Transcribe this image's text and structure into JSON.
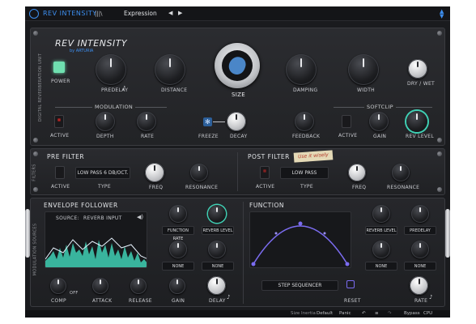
{
  "topbar": {
    "brand": "REV INTENSITY",
    "preset_name": "Expression"
  },
  "main": {
    "title": "REV INTENSITY",
    "subtitle": "by ARTURIA",
    "side_label": "DIGITAL REVERBERATION UNIT",
    "power_label": "POWER",
    "predelay_label": "PREDELAY",
    "distance_label": "DISTANCE",
    "size_label": "SIZE",
    "damping_label": "DAMPING",
    "width_label": "WIDTH",
    "drywet_label": "DRY / WET",
    "modulation_title": "MODULATION",
    "mod_active_label": "ACTIVE",
    "depth_label": "DEPTH",
    "rate_label": "RATE",
    "freeze_label": "FREEZE",
    "decay_label": "DECAY",
    "softclip_title": "SOFTCLIP",
    "feedback_label": "FEEDBACK",
    "sc_active_label": "ACTIVE",
    "gain_label": "GAIN",
    "revlevel_label": "REV LEVEL"
  },
  "filters": {
    "side_label": "FILTERS",
    "pre": {
      "title": "PRE FILTER",
      "active_label": "ACTIVE",
      "type_value": "LOW PASS 6 DB/OCT.",
      "type_label": "TYPE",
      "freq_label": "FREQ",
      "resonance_label": "RESONANCE"
    },
    "post": {
      "title": "POST FILTER",
      "active_label": "ACTIVE",
      "type_value": "LOW PASS",
      "type_label": "TYPE",
      "freq_label": "FREQ",
      "resonance_label": "RESONANCE",
      "sticky_note": "Use it wisely"
    }
  },
  "modulation": {
    "side_label": "MODULATION SOURCES",
    "envelope": {
      "title": "ENVELOPE FOLLOWER",
      "source_label": "SOURCE:",
      "source_value": "REVERB INPUT",
      "comp_label": "COMP",
      "off_label": "OFF",
      "attack_label": "ATTACK",
      "release_label": "RELEASE",
      "gain_label": "GAIN",
      "delay_label": "DELAY",
      "dest1": "FUNCTION RATE",
      "dest2": "REVERB LEVEL",
      "dest3": "NONE",
      "dest4": "NONE"
    },
    "function": {
      "title": "FUNCTION",
      "sequencer_label": "STEP SEQUENCER",
      "reset_label": "RESET",
      "rate_label": "RATE",
      "dest1": "REVERB LEVEL",
      "dest2": "PREDELAY",
      "dest3": "NONE",
      "dest4": "NONE"
    }
  },
  "bottombar": {
    "bypass_hint": "Size Inertia",
    "preset": "Default",
    "panic": "Panic",
    "bypass": "Bypass",
    "cpu": "CPU"
  },
  "colors": {
    "accent": "#3d8ff0",
    "waveform": "#3fd0b4",
    "function_curve": "#7b6cf0",
    "power_led": "#6fe0b0"
  }
}
